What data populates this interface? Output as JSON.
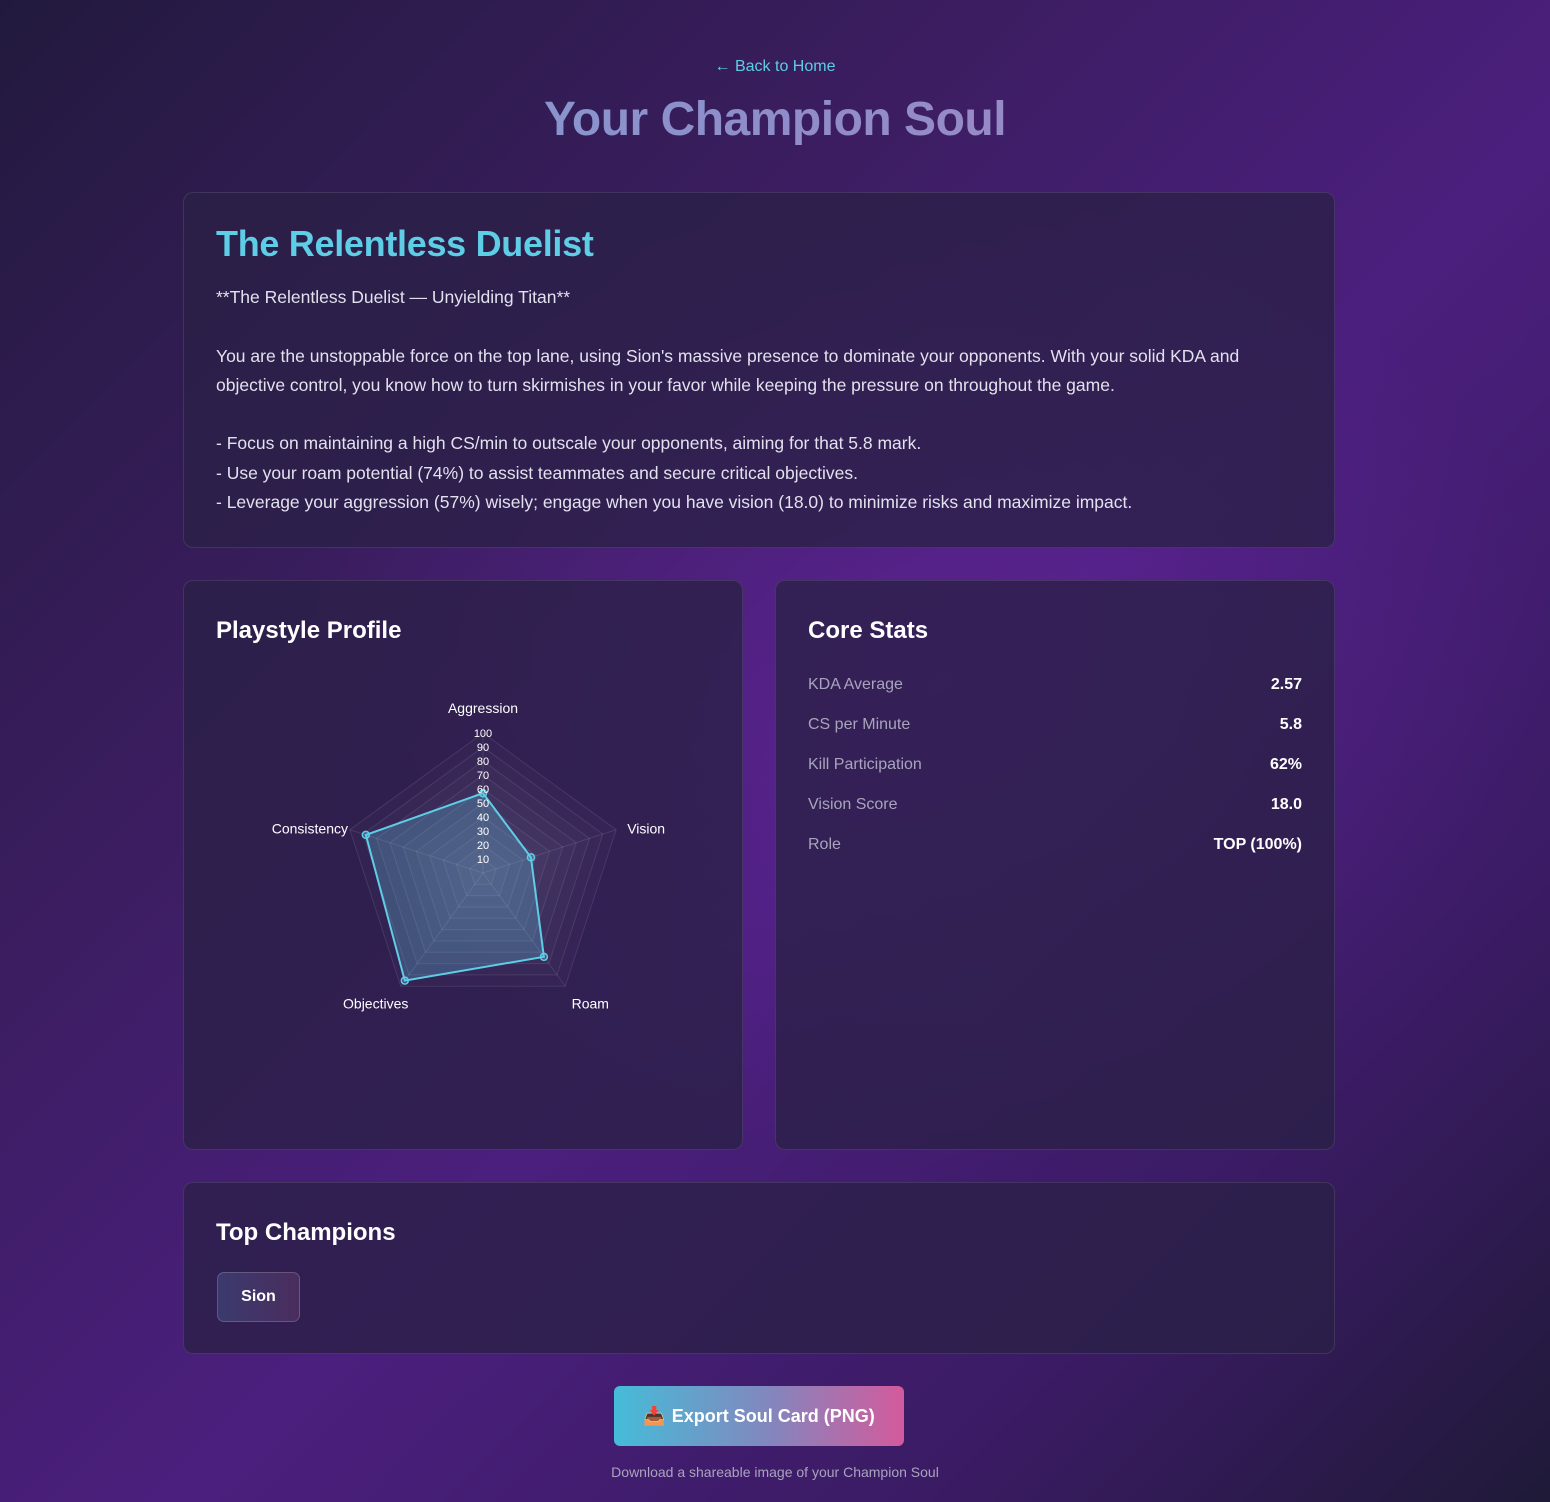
{
  "nav": {
    "back_label": "← Back to Home"
  },
  "page": {
    "title": "Your Champion Soul"
  },
  "soul": {
    "title": "The Relentless Duelist",
    "description": "**The Relentless Duelist — Unyielding Titan**\n\nYou are the unstoppable force on the top lane, using Sion's massive presence to dominate your opponents. With your solid KDA and objective control, you know how to turn skirmishes in your favor while keeping the pressure on throughout the game.\n\n- Focus on maintaining a high CS/min to outscale your opponents, aiming for that 5.8 mark.\n- Use your roam potential (74%) to assist teammates and secure critical objectives.\n- Leverage your aggression (57%) wisely; engage when you have vision (18.0) to minimize risks and maximize impact."
  },
  "playstyle": {
    "heading": "Playstyle Profile"
  },
  "chart_data": {
    "type": "radar",
    "axes": [
      "Aggression",
      "Vision",
      "Roam",
      "Objectives",
      "Consistency"
    ],
    "values": [
      57,
      36,
      74,
      95,
      88
    ],
    "ticks": [
      10,
      20,
      30,
      40,
      50,
      60,
      70,
      80,
      90,
      100
    ],
    "range": [
      0,
      100
    ],
    "line_color": "#5ecde6",
    "fill_color": "rgba(94,205,230,0.25)"
  },
  "core_stats": {
    "heading": "Core Stats",
    "rows": [
      {
        "label": "KDA Average",
        "value": "2.57"
      },
      {
        "label": "CS per Minute",
        "value": "5.8"
      },
      {
        "label": "Kill Participation",
        "value": "62%"
      },
      {
        "label": "Vision Score",
        "value": "18.0"
      },
      {
        "label": "Role",
        "value": "TOP (100%)"
      }
    ]
  },
  "top_champions": {
    "heading": "Top Champions",
    "champions": [
      "Sion"
    ]
  },
  "export": {
    "icon": "📥",
    "label": "Export Soul Card (PNG)",
    "caption": "Download a shareable image of your Champion Soul"
  },
  "colors": {
    "accent": "#5ecde6",
    "button_gradient_start": "#45bcd8",
    "button_gradient_end": "#d45a9c"
  }
}
